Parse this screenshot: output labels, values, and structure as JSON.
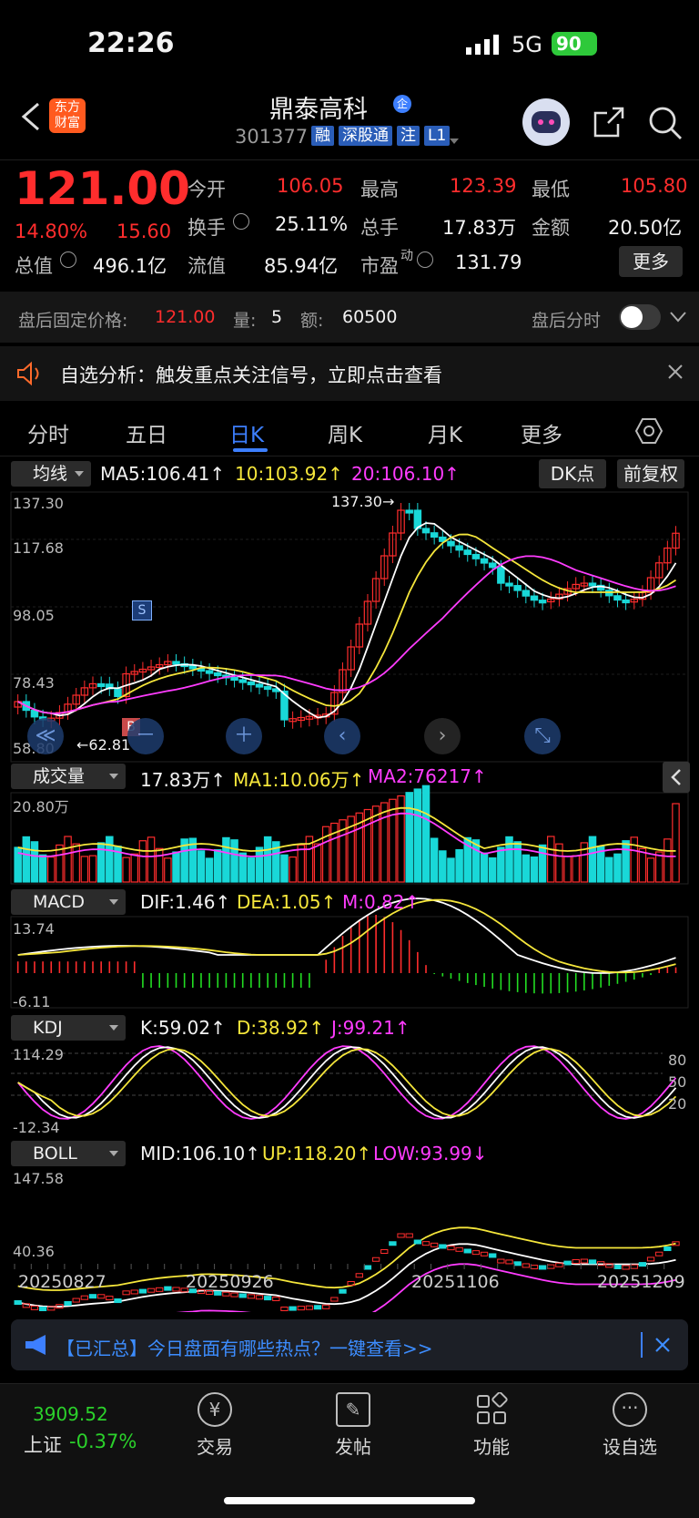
{
  "status_bar": {
    "time": "22:26",
    "network": "5G",
    "battery": "90"
  },
  "header": {
    "logo_text": "东方财富",
    "title": "鼎泰高科",
    "code": "301377",
    "tags": [
      "融",
      "深股通",
      "注",
      "L1"
    ],
    "badge": "企"
  },
  "quote": {
    "price": "121.00",
    "change_pct": "14.80%",
    "change": "15.60",
    "open_label": "今开",
    "open": "106.05",
    "high_label": "最高",
    "high": "123.39",
    "low_label": "最低",
    "low": "105.80",
    "turnover_label": "换手",
    "turnover": "25.11%",
    "volume_label": "总手",
    "volume": "17.83万",
    "amount_label": "金额",
    "amount": "20.50亿",
    "mktcap_label": "总值",
    "mktcap": "496.1亿",
    "float_label": "流值",
    "float_cap": "85.94亿",
    "pe_label": "市盈",
    "pe_sup": "动",
    "pe": "131.79",
    "more_button": "更多"
  },
  "after_hours": {
    "price_label": "盘后固定价格:",
    "price": "121.00",
    "qty_label": "量:",
    "qty": "5",
    "amt_label": "额:",
    "amt": "60500",
    "toggle_label": "盘后分时"
  },
  "notice": {
    "text": "自选分析：触发重点关注信号，立即点击查看"
  },
  "tabs": [
    "分时",
    "五日",
    "日K",
    "周K",
    "月K",
    "更多"
  ],
  "active_tab": "日K",
  "ma_bar": {
    "selector": "均线",
    "ma5": "MA5:106.41↑",
    "ma10": "10:103.92↑",
    "ma20": "20:106.10↑",
    "dk_button": "DK点",
    "adj_button": "前复权"
  },
  "kline_axis": {
    "y1": "137.30",
    "y2": "117.68",
    "y3": "98.05",
    "y4": "78.43",
    "y5": "58.80",
    "max_note": "137.30→",
    "min_note": "←62.81",
    "signal_s": "S",
    "signal_b": "B"
  },
  "volume_bar": {
    "selector": "成交量",
    "v": "17.83万↑",
    "ma1": "MA1:10.06万↑",
    "ma2": "MA2:76217↑",
    "axis_top": "20.80万"
  },
  "macd_bar": {
    "selector": "MACD",
    "dif": "DIF:1.46↑",
    "dea": "DEA:1.05↑",
    "m": "M:0.82↑",
    "axis_top": "13.74",
    "axis_bottom": "-6.11"
  },
  "kdj_bar": {
    "selector": "KDJ",
    "k": "K:59.02↑",
    "d": "D:38.92↑",
    "j": "J:99.21↑",
    "axis_top": "114.29",
    "axis_bottom": "-12.34",
    "l80": "80",
    "l50": "50",
    "l20": "20"
  },
  "boll_bar": {
    "selector": "BOLL",
    "mid": "MID:106.10↑",
    "up": "UP:118.20↑",
    "low": "LOW:93.99↓",
    "axis_top": "147.58",
    "axis_bottom": "40.36"
  },
  "dates": [
    "20250827",
    "20250926",
    "20251106",
    "20251209"
  ],
  "news": {
    "text": "【已汇总】今日盘面有哪些热点？一键查看>>"
  },
  "bottom_nav": {
    "index_value": "3909.52",
    "index_name": "上证",
    "index_change": "-0.37%",
    "items": [
      "交易",
      "发帖",
      "功能",
      "设自选"
    ]
  },
  "colors": {
    "up": "#ff2d2d",
    "down": "#19d8d8",
    "ma5": "#ffffff",
    "ma10": "#f5e63b",
    "ma20": "#ff3cff",
    "accent": "#3d7fff"
  }
}
